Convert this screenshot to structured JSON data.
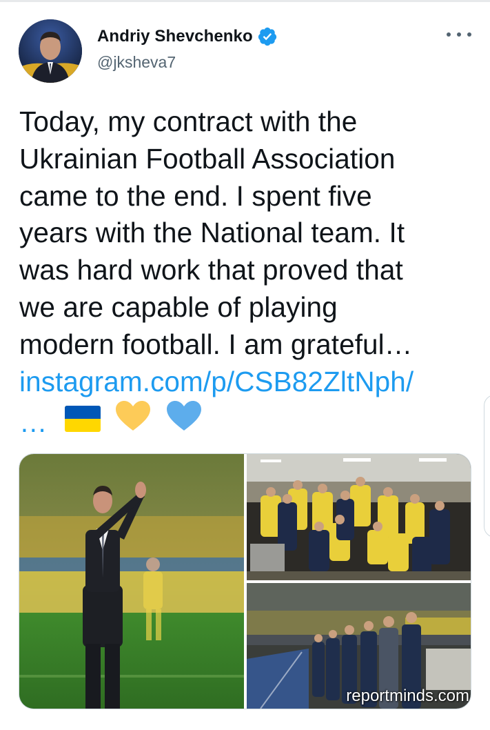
{
  "author": {
    "display_name": "Andriy Shevchenko",
    "handle": "@jksheva7",
    "verified": true,
    "avatar_icon": "profile-photo"
  },
  "menu": {
    "icon": "more-dots-icon"
  },
  "tweet": {
    "lines": [
      "Today, my contract with the",
      "Ukrainian Football Association",
      "came to the end. I spent five",
      "years with the National team. It",
      "was hard work that proved that",
      "we are capable of playing",
      "modern football. I am grateful…"
    ],
    "link_text": "instagram.com/p/CSB82ZltNph/",
    "link_ellipsis": "…",
    "emojis": [
      "ukraine-flag",
      "yellow-heart",
      "blue-heart"
    ]
  },
  "media": {
    "photos": [
      "coach-applauding-photo",
      "team-celebrating-locker-room-photo",
      "anthem-sideline-photo"
    ],
    "watermark": "reportminds.com"
  },
  "colors": {
    "link": "#1d9bf0",
    "verified": "#1d9bf0",
    "text": "#0f1419",
    "secondary": "#536471",
    "flag_blue": "#0057b7",
    "flag_yellow": "#ffd700"
  }
}
